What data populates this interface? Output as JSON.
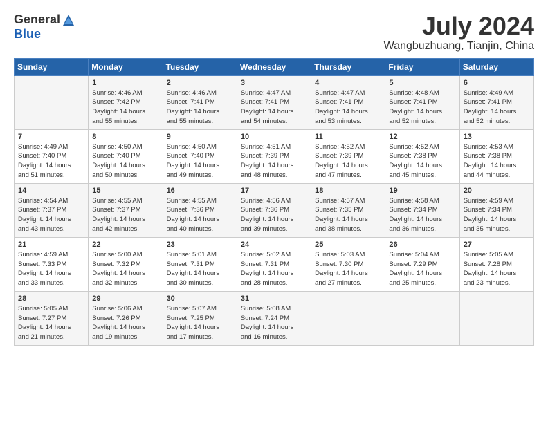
{
  "header": {
    "logo_general": "General",
    "logo_blue": "Blue",
    "month_title": "July 2024",
    "location": "Wangbuzhuang, Tianjin, China"
  },
  "days_of_week": [
    "Sunday",
    "Monday",
    "Tuesday",
    "Wednesday",
    "Thursday",
    "Friday",
    "Saturday"
  ],
  "weeks": [
    [
      {
        "day": "",
        "info": ""
      },
      {
        "day": "1",
        "info": "Sunrise: 4:46 AM\nSunset: 7:42 PM\nDaylight: 14 hours\nand 55 minutes."
      },
      {
        "day": "2",
        "info": "Sunrise: 4:46 AM\nSunset: 7:41 PM\nDaylight: 14 hours\nand 55 minutes."
      },
      {
        "day": "3",
        "info": "Sunrise: 4:47 AM\nSunset: 7:41 PM\nDaylight: 14 hours\nand 54 minutes."
      },
      {
        "day": "4",
        "info": "Sunrise: 4:47 AM\nSunset: 7:41 PM\nDaylight: 14 hours\nand 53 minutes."
      },
      {
        "day": "5",
        "info": "Sunrise: 4:48 AM\nSunset: 7:41 PM\nDaylight: 14 hours\nand 52 minutes."
      },
      {
        "day": "6",
        "info": "Sunrise: 4:49 AM\nSunset: 7:41 PM\nDaylight: 14 hours\nand 52 minutes."
      }
    ],
    [
      {
        "day": "7",
        "info": "Sunrise: 4:49 AM\nSunset: 7:40 PM\nDaylight: 14 hours\nand 51 minutes."
      },
      {
        "day": "8",
        "info": "Sunrise: 4:50 AM\nSunset: 7:40 PM\nDaylight: 14 hours\nand 50 minutes."
      },
      {
        "day": "9",
        "info": "Sunrise: 4:50 AM\nSunset: 7:40 PM\nDaylight: 14 hours\nand 49 minutes."
      },
      {
        "day": "10",
        "info": "Sunrise: 4:51 AM\nSunset: 7:39 PM\nDaylight: 14 hours\nand 48 minutes."
      },
      {
        "day": "11",
        "info": "Sunrise: 4:52 AM\nSunset: 7:39 PM\nDaylight: 14 hours\nand 47 minutes."
      },
      {
        "day": "12",
        "info": "Sunrise: 4:52 AM\nSunset: 7:38 PM\nDaylight: 14 hours\nand 45 minutes."
      },
      {
        "day": "13",
        "info": "Sunrise: 4:53 AM\nSunset: 7:38 PM\nDaylight: 14 hours\nand 44 minutes."
      }
    ],
    [
      {
        "day": "14",
        "info": "Sunrise: 4:54 AM\nSunset: 7:37 PM\nDaylight: 14 hours\nand 43 minutes."
      },
      {
        "day": "15",
        "info": "Sunrise: 4:55 AM\nSunset: 7:37 PM\nDaylight: 14 hours\nand 42 minutes."
      },
      {
        "day": "16",
        "info": "Sunrise: 4:55 AM\nSunset: 7:36 PM\nDaylight: 14 hours\nand 40 minutes."
      },
      {
        "day": "17",
        "info": "Sunrise: 4:56 AM\nSunset: 7:36 PM\nDaylight: 14 hours\nand 39 minutes."
      },
      {
        "day": "18",
        "info": "Sunrise: 4:57 AM\nSunset: 7:35 PM\nDaylight: 14 hours\nand 38 minutes."
      },
      {
        "day": "19",
        "info": "Sunrise: 4:58 AM\nSunset: 7:34 PM\nDaylight: 14 hours\nand 36 minutes."
      },
      {
        "day": "20",
        "info": "Sunrise: 4:59 AM\nSunset: 7:34 PM\nDaylight: 14 hours\nand 35 minutes."
      }
    ],
    [
      {
        "day": "21",
        "info": "Sunrise: 4:59 AM\nSunset: 7:33 PM\nDaylight: 14 hours\nand 33 minutes."
      },
      {
        "day": "22",
        "info": "Sunrise: 5:00 AM\nSunset: 7:32 PM\nDaylight: 14 hours\nand 32 minutes."
      },
      {
        "day": "23",
        "info": "Sunrise: 5:01 AM\nSunset: 7:31 PM\nDaylight: 14 hours\nand 30 minutes."
      },
      {
        "day": "24",
        "info": "Sunrise: 5:02 AM\nSunset: 7:31 PM\nDaylight: 14 hours\nand 28 minutes."
      },
      {
        "day": "25",
        "info": "Sunrise: 5:03 AM\nSunset: 7:30 PM\nDaylight: 14 hours\nand 27 minutes."
      },
      {
        "day": "26",
        "info": "Sunrise: 5:04 AM\nSunset: 7:29 PM\nDaylight: 14 hours\nand 25 minutes."
      },
      {
        "day": "27",
        "info": "Sunrise: 5:05 AM\nSunset: 7:28 PM\nDaylight: 14 hours\nand 23 minutes."
      }
    ],
    [
      {
        "day": "28",
        "info": "Sunrise: 5:05 AM\nSunset: 7:27 PM\nDaylight: 14 hours\nand 21 minutes."
      },
      {
        "day": "29",
        "info": "Sunrise: 5:06 AM\nSunset: 7:26 PM\nDaylight: 14 hours\nand 19 minutes."
      },
      {
        "day": "30",
        "info": "Sunrise: 5:07 AM\nSunset: 7:25 PM\nDaylight: 14 hours\nand 17 minutes."
      },
      {
        "day": "31",
        "info": "Sunrise: 5:08 AM\nSunset: 7:24 PM\nDaylight: 14 hours\nand 16 minutes."
      },
      {
        "day": "",
        "info": ""
      },
      {
        "day": "",
        "info": ""
      },
      {
        "day": "",
        "info": ""
      }
    ]
  ]
}
